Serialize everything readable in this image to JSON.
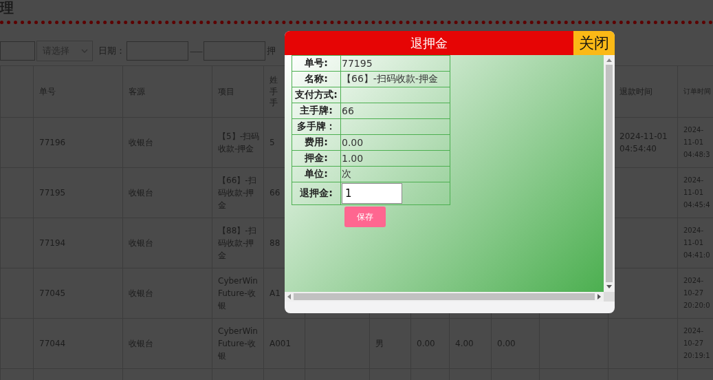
{
  "page_title": "理",
  "filters": {
    "select_placeholder": "请选择",
    "date_label": "日期：",
    "range_separator": "——",
    "deposit_label": "押"
  },
  "table": {
    "columns": [
      null,
      "单号",
      "客源",
      "项目",
      "姓手手",
      null,
      null,
      null,
      null,
      null,
      null,
      "退款时间",
      "订单时间"
    ],
    "rows": [
      {
        "cells": [
          null,
          "77196",
          "收银台",
          "【5】-扫码收款-押金",
          "5",
          null,
          null,
          null,
          null,
          null,
          null,
          "2024-11-01 04:54:40",
          "2024-11-01 04:48:3"
        ]
      },
      {
        "cells": [
          null,
          "77195",
          "收银台",
          "【66】-扫码收款-押金",
          "66",
          null,
          null,
          null,
          null,
          null,
          null,
          null,
          "2024-11-01 04:45:4"
        ]
      },
      {
        "cells": [
          null,
          "77194",
          "收银台",
          "【88】-扫码收款-押金",
          "88",
          null,
          null,
          null,
          null,
          null,
          null,
          null,
          "2024-11-01 04:41:0"
        ]
      },
      {
        "cells": [
          null,
          "77045",
          "收银台",
          "CyberWin Future-收银",
          "A1",
          null,
          null,
          null,
          null,
          null,
          null,
          null,
          "2024-10-27 20:20:0"
        ]
      },
      {
        "cells": [
          null,
          "77044",
          "收银台",
          "CyberWin Future-收银",
          "A001",
          null,
          "男",
          "0.00",
          "4.00",
          "0.00",
          null,
          null,
          "2024-10-27 20:19:1"
        ]
      }
    ]
  },
  "dialog": {
    "title": "退押金",
    "close": "关闭",
    "fields": [
      {
        "kind": "text",
        "label": "单号:",
        "value": "77195"
      },
      {
        "kind": "text",
        "label": "名称:",
        "value": "【66】-扫码收款-押金"
      },
      {
        "kind": "text",
        "label": "支付方式:"
      },
      {
        "kind": "text",
        "label": "主手牌:",
        "value": "66"
      },
      {
        "kind": "text",
        "label": "多手牌："
      },
      {
        "kind": "text",
        "label": "费用:",
        "value": "0.00"
      },
      {
        "kind": "text",
        "label": "押金:",
        "value": "1.00"
      },
      {
        "kind": "text",
        "label": "单位:",
        "value": "次"
      },
      {
        "kind": "input",
        "label": "退押金:",
        "value": "1"
      }
    ],
    "save": "保存"
  }
}
